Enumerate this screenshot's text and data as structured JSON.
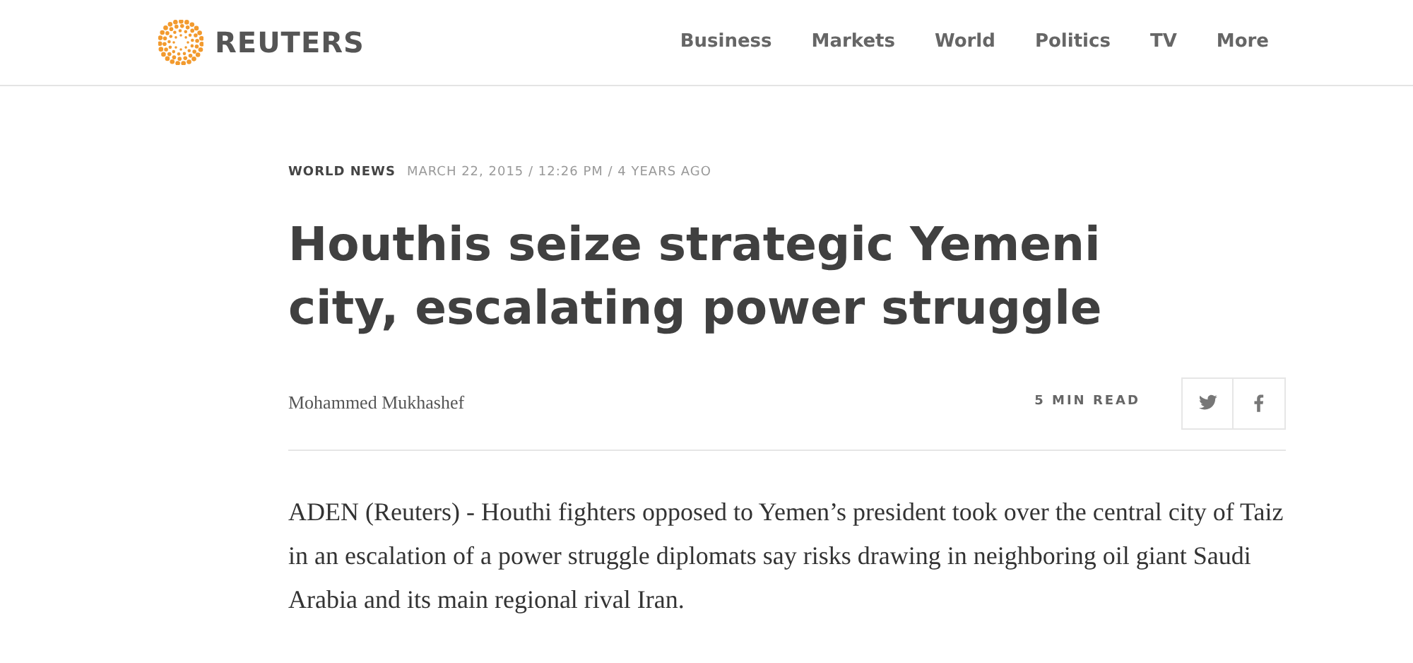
{
  "header": {
    "brand": "REUTERS",
    "nav": [
      {
        "label": "Business"
      },
      {
        "label": "Markets"
      },
      {
        "label": "World"
      },
      {
        "label": "Politics"
      },
      {
        "label": "TV"
      },
      {
        "label": "More"
      }
    ]
  },
  "article": {
    "section": "WORLD NEWS",
    "dateline": "MARCH 22, 2015 / 12:26 PM / 4 YEARS AGO",
    "headline": "Houthis seize strategic Yemeni city, escalating power struggle",
    "byline": "Mohammed Mukhashef",
    "read_time": "5 MIN READ",
    "share": [
      {
        "kind": "twitter"
      },
      {
        "kind": "facebook"
      }
    ],
    "body": "ADEN (Reuters) - Houthi fighters opposed to Yemen’s president took over the central city of Taiz in an escalation of a power struggle diplomats say risks drawing in neighboring oil giant Saudi Arabia and its main regional rival Iran."
  }
}
